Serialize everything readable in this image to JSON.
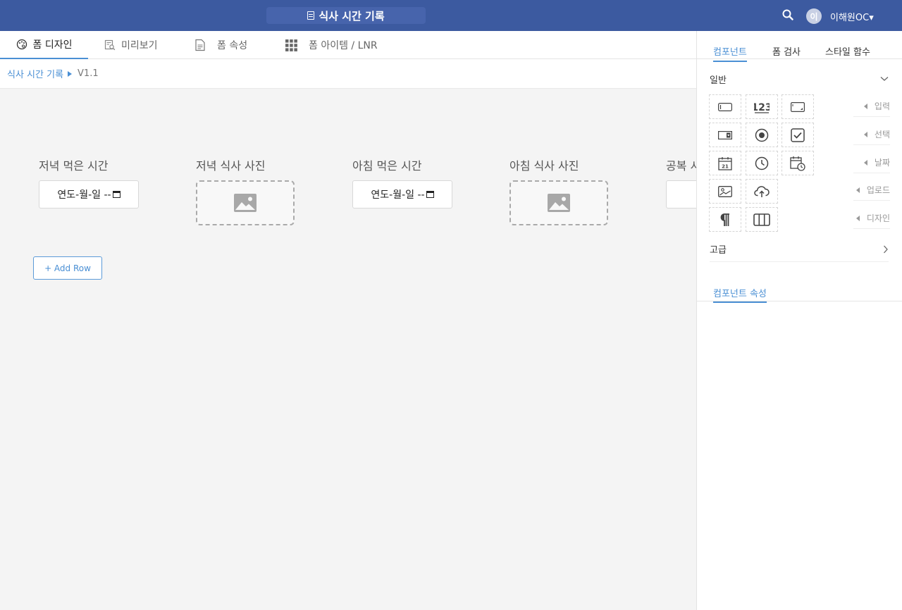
{
  "topbar": {
    "title": "식사 시간 기록",
    "avatar_initial": "이",
    "user_name": "이해원OC▾",
    "colors": {
      "bar": "#3c5aa0",
      "accent": "#4a8fd4"
    }
  },
  "tabs": [
    {
      "label": "폼 디자인",
      "icon": "palette-icon",
      "active": true
    },
    {
      "label": "미리보기",
      "icon": "preview-icon",
      "active": false
    },
    {
      "label": "폼 속성",
      "icon": "document-icon",
      "active": false
    },
    {
      "label": "폼 아이템 / LNR",
      "icon": "grid-icon",
      "active": false
    }
  ],
  "breadcrumb": {
    "link": "식사 시간 기록",
    "version": "V1.1"
  },
  "form": {
    "fields": [
      {
        "label": "저녁 먹은 시간",
        "type": "date",
        "value": "연도-월-일 --"
      },
      {
        "label": "저녁 식사 사진",
        "type": "photo"
      },
      {
        "label": "아침 먹은 시간",
        "type": "date",
        "value": "연도-월-일 --"
      },
      {
        "label": "아침 식사 사진",
        "type": "photo"
      },
      {
        "label": "공복 시",
        "type": "cut"
      }
    ],
    "add_row_label": "+ Add Row"
  },
  "panel": {
    "tabs": [
      {
        "label": "컴포넌트",
        "active": true
      },
      {
        "label": "폼 검사",
        "active": false
      },
      {
        "label": "스타일 함수",
        "active": false
      }
    ],
    "general_label": "일반",
    "advanced_label": "고급",
    "categories": [
      "입력",
      "선택",
      "날짜",
      "업로드",
      "디자인"
    ],
    "component_props_label": "컴포넌트 속성"
  }
}
